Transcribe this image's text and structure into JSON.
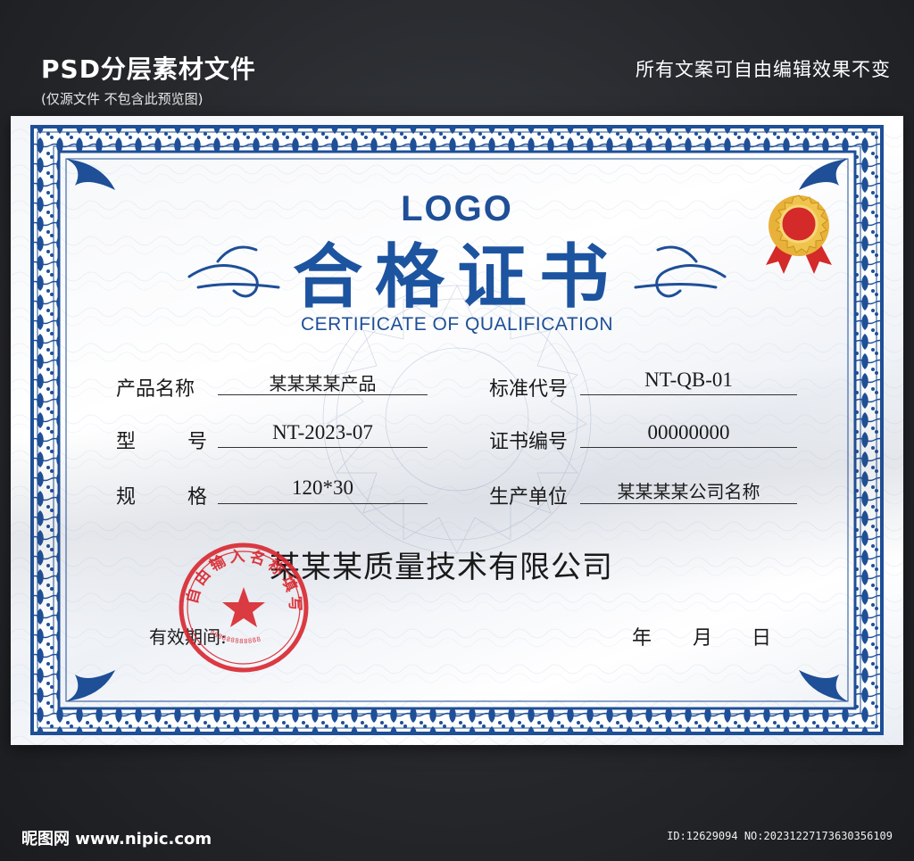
{
  "header": {
    "title": "PSD分层素材文件",
    "subtitle": "(仅源文件 不包含此预览图)",
    "right_note": "所有文案可自由编辑效果不变"
  },
  "certificate": {
    "logo": "LOGO",
    "title": "合格证书",
    "subtitle": "CERTIFICATE OF QUALIFICATION",
    "fields": {
      "product_name_label": "产品名称",
      "product_name_value": "某某某某产品",
      "standard_code_label": "标准代号",
      "standard_code_value": "NT-QB-01",
      "model_label_1": "型",
      "model_label_2": "号",
      "model_value": "NT-2023-07",
      "cert_no_label": "证书编号",
      "cert_no_value": "00000000",
      "spec_label_1": "规",
      "spec_label_2": "格",
      "spec_value": "120*30",
      "producer_label": "生产单位",
      "producer_value": "某某某某公司名称"
    },
    "company": "某某某质量技术有限公司",
    "validity_label": "有效期间:",
    "date": {
      "year": "年",
      "month": "月",
      "day": "日"
    },
    "seal": {
      "ring_text": "自由输入名称填写",
      "bottom_digits": "888888888888"
    }
  },
  "footer": {
    "left": "昵图网 www.nipic.com",
    "right": "ID:12629094 NO:20231227173630356109"
  },
  "colors": {
    "border_blue": "#1e4f97",
    "seal_red": "#d8262e",
    "medal_gold": "#e8b23a",
    "medal_red": "#d42a2a"
  }
}
